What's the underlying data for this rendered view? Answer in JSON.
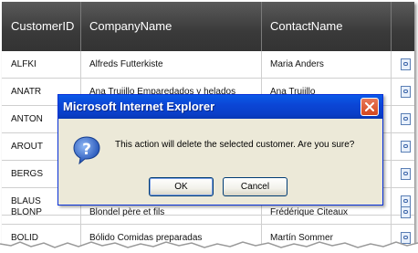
{
  "grid": {
    "columns": [
      {
        "key": "id",
        "label": "CustomerID"
      },
      {
        "key": "company",
        "label": "CompanyName"
      },
      {
        "key": "contact",
        "label": "ContactName"
      }
    ],
    "rows": [
      {
        "id": "ALFKI",
        "company": "Alfreds Futterkiste",
        "contact": "Maria Anders"
      },
      {
        "id": "ANATR",
        "company": "Ana Trujillo Emparedados y helados",
        "contact": "Ana Trujillo"
      },
      {
        "id": "ANTON",
        "company": "",
        "contact": ""
      },
      {
        "id": "AROUT",
        "company": "",
        "contact": ""
      },
      {
        "id": "BERGS",
        "company": "",
        "contact": ""
      },
      {
        "id": "BLAUS",
        "company": "",
        "contact": ""
      },
      {
        "id": "BLONP",
        "company": "Blondel père et fils",
        "contact": "Frédérique Citeaux"
      },
      {
        "id": "BOLID",
        "company": "Bólido Comidas preparadas",
        "contact": "Martín Sommer"
      }
    ],
    "row_icon": "page-edit-icon"
  },
  "dialog": {
    "title": "Microsoft Internet Explorer",
    "message": "This action will delete the selected customer. Are you sure?",
    "ok_label": "OK",
    "cancel_label": "Cancel",
    "icon": "question-icon",
    "close_icon": "close-icon"
  },
  "colors": {
    "header_bg": "#3a3a3a",
    "titlebar": "#0b46d6",
    "dialog_bg": "#ece9d8",
    "close_button": "#d4471e"
  }
}
